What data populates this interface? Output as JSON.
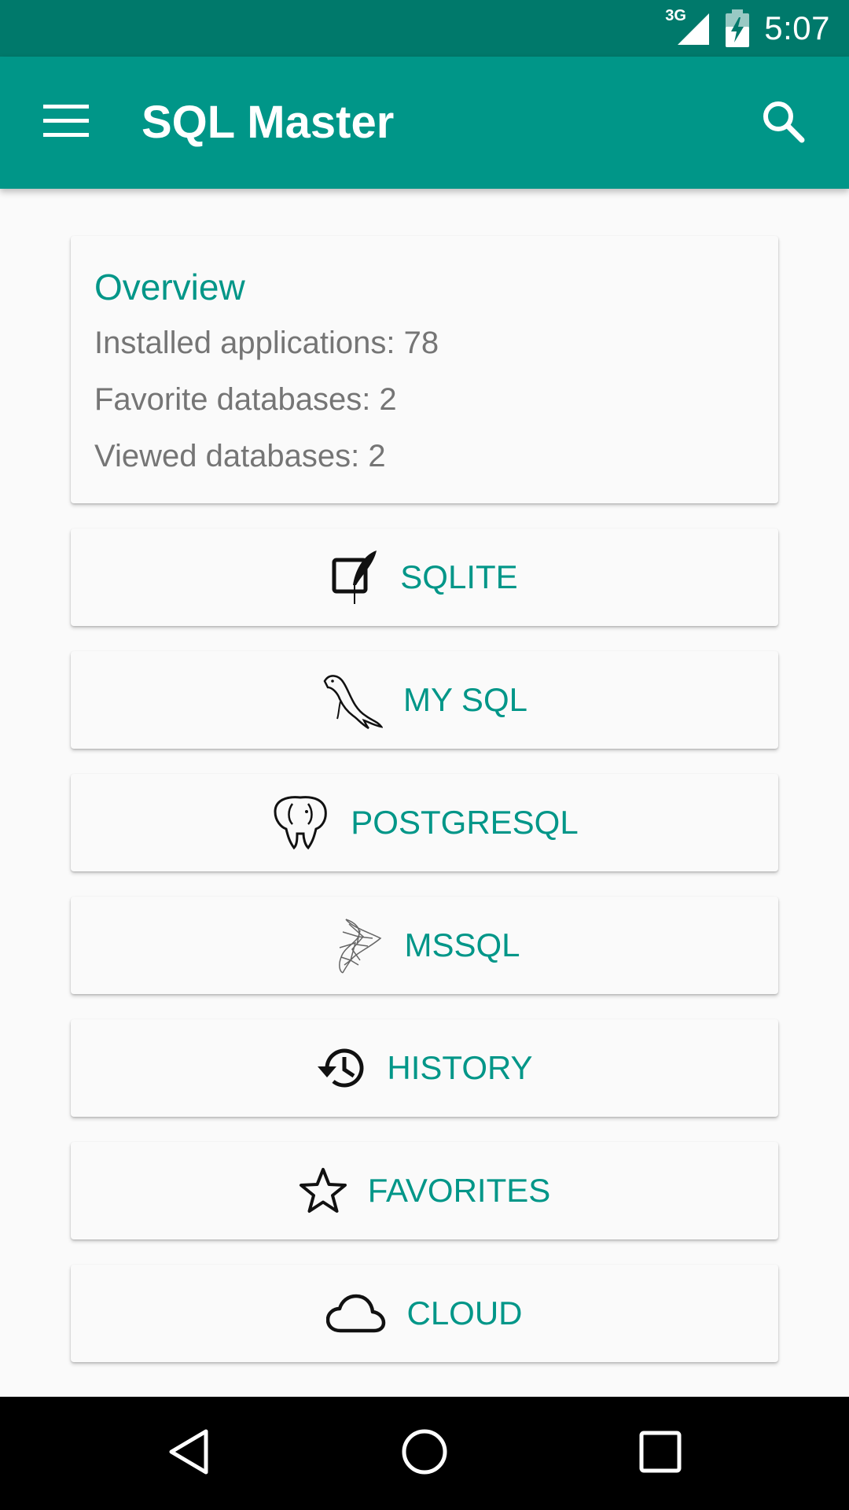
{
  "status_bar": {
    "network": "3G",
    "time": "5:07",
    "icons": [
      "signal-icon",
      "battery-charging-icon"
    ]
  },
  "app_bar": {
    "title": "SQL Master",
    "icons": [
      "menu-icon",
      "search-icon"
    ]
  },
  "overview": {
    "title": "Overview",
    "lines": [
      "Installed applications: 78",
      "Favorite databases: 2",
      "Viewed databases: 2"
    ]
  },
  "buttons": [
    {
      "label": "SQLITE",
      "icon": "sqlite-feather-icon"
    },
    {
      "label": "MY SQL",
      "icon": "mysql-dolphin-icon"
    },
    {
      "label": "POSTGRESQL",
      "icon": "postgresql-elephant-icon"
    },
    {
      "label": "MSSQL",
      "icon": "mssql-icon"
    },
    {
      "label": "HISTORY",
      "icon": "history-icon"
    },
    {
      "label": "FAVORITES",
      "icon": "star-icon"
    },
    {
      "label": "CLOUD",
      "icon": "cloud-icon"
    }
  ],
  "nav_bar": {
    "icons": [
      "back-icon",
      "home-icon",
      "recents-icon"
    ]
  },
  "colors": {
    "primary": "#009688",
    "primary_dark": "#00796b",
    "accent_text": "#009688",
    "secondary_text": "#757575",
    "background": "#fafafa"
  }
}
